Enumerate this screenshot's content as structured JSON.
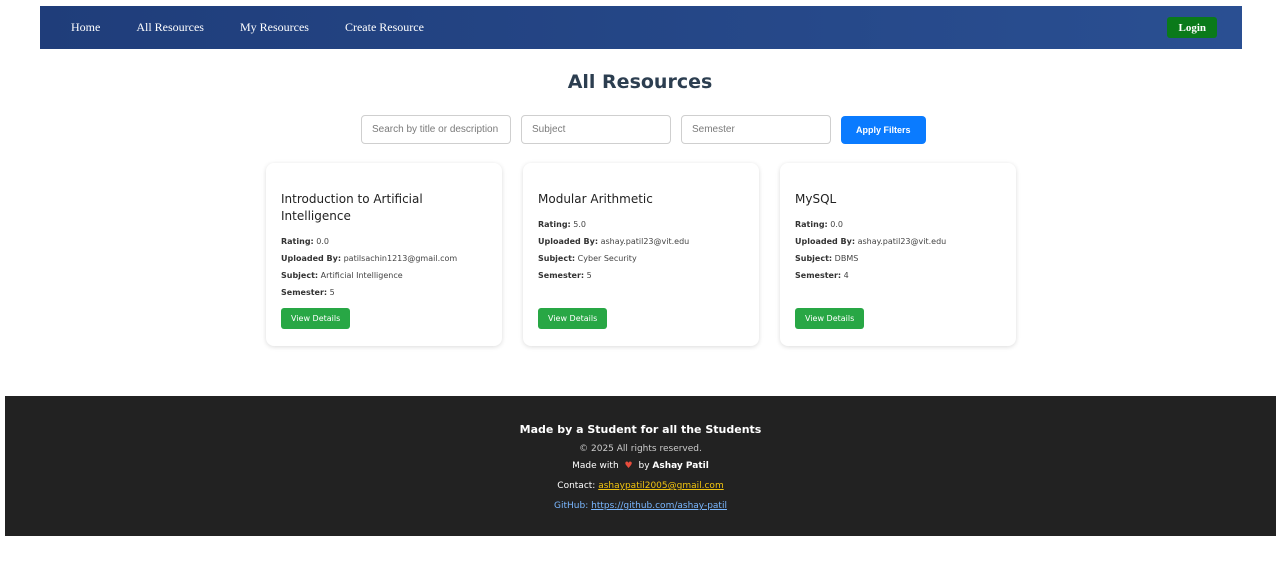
{
  "nav": {
    "links": [
      "Home",
      "All Resources",
      "My Resources",
      "Create Resource"
    ],
    "login_label": "Login"
  },
  "page": {
    "title": "All Resources"
  },
  "filters": {
    "search_placeholder": "Search by title or description",
    "subject_placeholder": "Subject",
    "semester_placeholder": "Semester",
    "apply_label": "Apply Filters"
  },
  "labels": {
    "rating": "Rating:",
    "uploaded_by": "Uploaded By:",
    "subject": "Subject:",
    "semester": "Semester:",
    "view_details": "View Details"
  },
  "resources": [
    {
      "title": "Introduction to Artificial Intelligence",
      "rating": "0.0",
      "uploaded_by": "patilsachin1213@gmail.com",
      "subject": "Artificial Intelligence",
      "semester": "5"
    },
    {
      "title": "Modular Arithmetic",
      "rating": "5.0",
      "uploaded_by": "ashay.patil23@vit.edu",
      "subject": "Cyber Security",
      "semester": "5"
    },
    {
      "title": "MySQL",
      "rating": "0.0",
      "uploaded_by": "ashay.patil23@vit.edu",
      "subject": "DBMS",
      "semester": "4"
    }
  ],
  "footer": {
    "tagline": "Made by a Student for all the Students",
    "copyright": "© 2025 All rights reserved.",
    "made_with": "Made with",
    "heart_icon": "heart-icon",
    "by": "by",
    "author": "Ashay Patil",
    "contact_label": "Contact:",
    "contact_email": "ashaypatil2005@gmail.com",
    "github_label": "GitHub:",
    "github_url": "https://github.com/ashay-patil"
  },
  "colors": {
    "nav_bg": "#2a4f92",
    "login_bg": "#0a7a1a",
    "apply_bg": "#0a7bff",
    "view_bg": "#28a745",
    "footer_bg": "#222222"
  }
}
